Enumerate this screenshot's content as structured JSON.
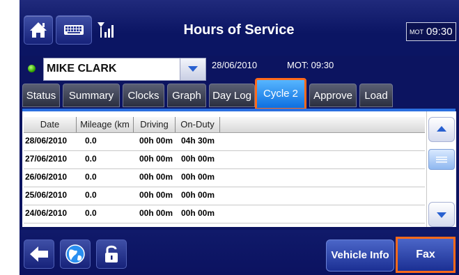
{
  "header": {
    "title": "Hours of Service",
    "mot_label": "MOT",
    "time": "09:30",
    "icons": [
      "home-icon",
      "keyboard-icon",
      "signal-icon"
    ]
  },
  "driver": {
    "name": "MIKE CLARK",
    "status_color": "#34a800",
    "date": "28/06/2010",
    "mot_text": "MOT: 09:30"
  },
  "tabs": [
    {
      "label": "Status"
    },
    {
      "label": "Summary"
    },
    {
      "label": "Clocks"
    },
    {
      "label": "Graph"
    },
    {
      "label": "Day Log"
    },
    {
      "label": "Cycle 2",
      "active": true
    },
    {
      "label": "Approve"
    },
    {
      "label": "Load"
    }
  ],
  "table": {
    "columns": [
      "Date",
      "Mileage (km",
      "Driving",
      "On-Duty"
    ],
    "rows": [
      {
        "date": "28/06/2010",
        "mileage": "0.0",
        "driving": "00h 00m",
        "on_duty": "04h 30m"
      },
      {
        "date": "27/06/2010",
        "mileage": "0.0",
        "driving": "00h 00m",
        "on_duty": "00h 00m"
      },
      {
        "date": "26/06/2010",
        "mileage": "0.0",
        "driving": "00h 00m",
        "on_duty": "00h 00m"
      },
      {
        "date": "25/06/2010",
        "mileage": "0.0",
        "driving": "00h 00m",
        "on_duty": "00h 00m"
      },
      {
        "date": "24/06/2010",
        "mileage": "0.0",
        "driving": "00h 00m",
        "on_duty": "00h 00m"
      }
    ]
  },
  "footer": {
    "vehicle_info": "Vehicle Info",
    "fax": "Fax",
    "icons": [
      "back-arrow-icon",
      "globe-icon",
      "unlock-icon"
    ]
  },
  "colors": {
    "background": "#0c1460",
    "active_tab": "#1a86f0",
    "highlight": "#ff6a1a"
  }
}
